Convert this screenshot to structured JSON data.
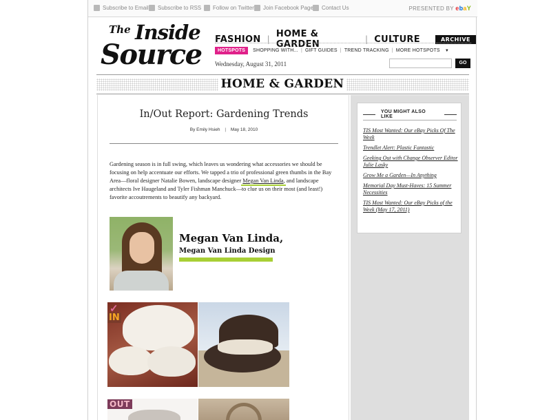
{
  "topbar": {
    "links": [
      {
        "label": "Subscribe to Email",
        "icon": "email-icon"
      },
      {
        "label": "Subscribe to RSS",
        "icon": "rss-icon"
      },
      {
        "label": "Follow on Twitter",
        "icon": "twitter-icon"
      },
      {
        "label": "Join Facebook Page",
        "icon": "facebook-icon"
      },
      {
        "label": "Contact Us",
        "icon": "contact-icon"
      }
    ],
    "presented_by": "PRESENTED BY",
    "sponsor": {
      "e": "e",
      "b": "b",
      "a": "a",
      "y": "Y"
    }
  },
  "logo": {
    "the": "The",
    "inside": "Inside",
    "source": "Source"
  },
  "nav": {
    "items": [
      "FASHION",
      "HOME & GARDEN",
      "CULTURE"
    ],
    "separator": "|",
    "archive": "ARCHIVE",
    "hotspots_label": "HOTSPOTS",
    "hotspots": [
      "SHOPPING WITH...",
      "GIFT GUIDES",
      "TREND TRACKING",
      "MORE HOTSPOTS"
    ],
    "caret": "▼"
  },
  "date": "Wednesday, August 31, 2011",
  "search": {
    "go": "GO",
    "placeholder": ""
  },
  "section": {
    "title": "HOME & GARDEN"
  },
  "article": {
    "title": "In/Out Report: Gardening Trends",
    "author": "By Emily Hsieh",
    "byline_sep": "|",
    "date": "May 18, 2010",
    "body_before": "Gardening season is in full swing, which leaves us wondering what accessories we should be focusing on help accentuate our efforts. We tapped a trio of professional green thumbs in the Bay Area—floral designer Natalie Bowen, landscape designer ",
    "body_link": "Megan Van Linda",
    "body_after": ", and landscape architects Ive Haugeland and Tyler Fishman Manchuck—to clue us on their most (and least!) favorite accoutrements to beautify any backyard."
  },
  "profile": {
    "name": "Megan Van Linda,",
    "company": "Megan Van Linda Design"
  },
  "badges": {
    "in": "IN",
    "in_check": "✓",
    "out": "OUT"
  },
  "sidebar": {
    "title": "YOU MIGHT ALSO LIKE",
    "items": [
      "TIS Most Wanted: Our eBay Picks Of The Week",
      "Trendlet Alert: Plastic Fantastic",
      "Geeking Out with Change Observer Editor Julie Lasky",
      "Grow Me a Garden—In Anything",
      "Memorial Day Must-Haves: 15 Summer Necessities",
      "TIS Most Wanted: Our eBay Picks of the Week (May 17, 2011)"
    ]
  },
  "colors": {
    "hotspot": "#e0218a",
    "accent_green": "#a8cf35",
    "ink": "#111111"
  }
}
